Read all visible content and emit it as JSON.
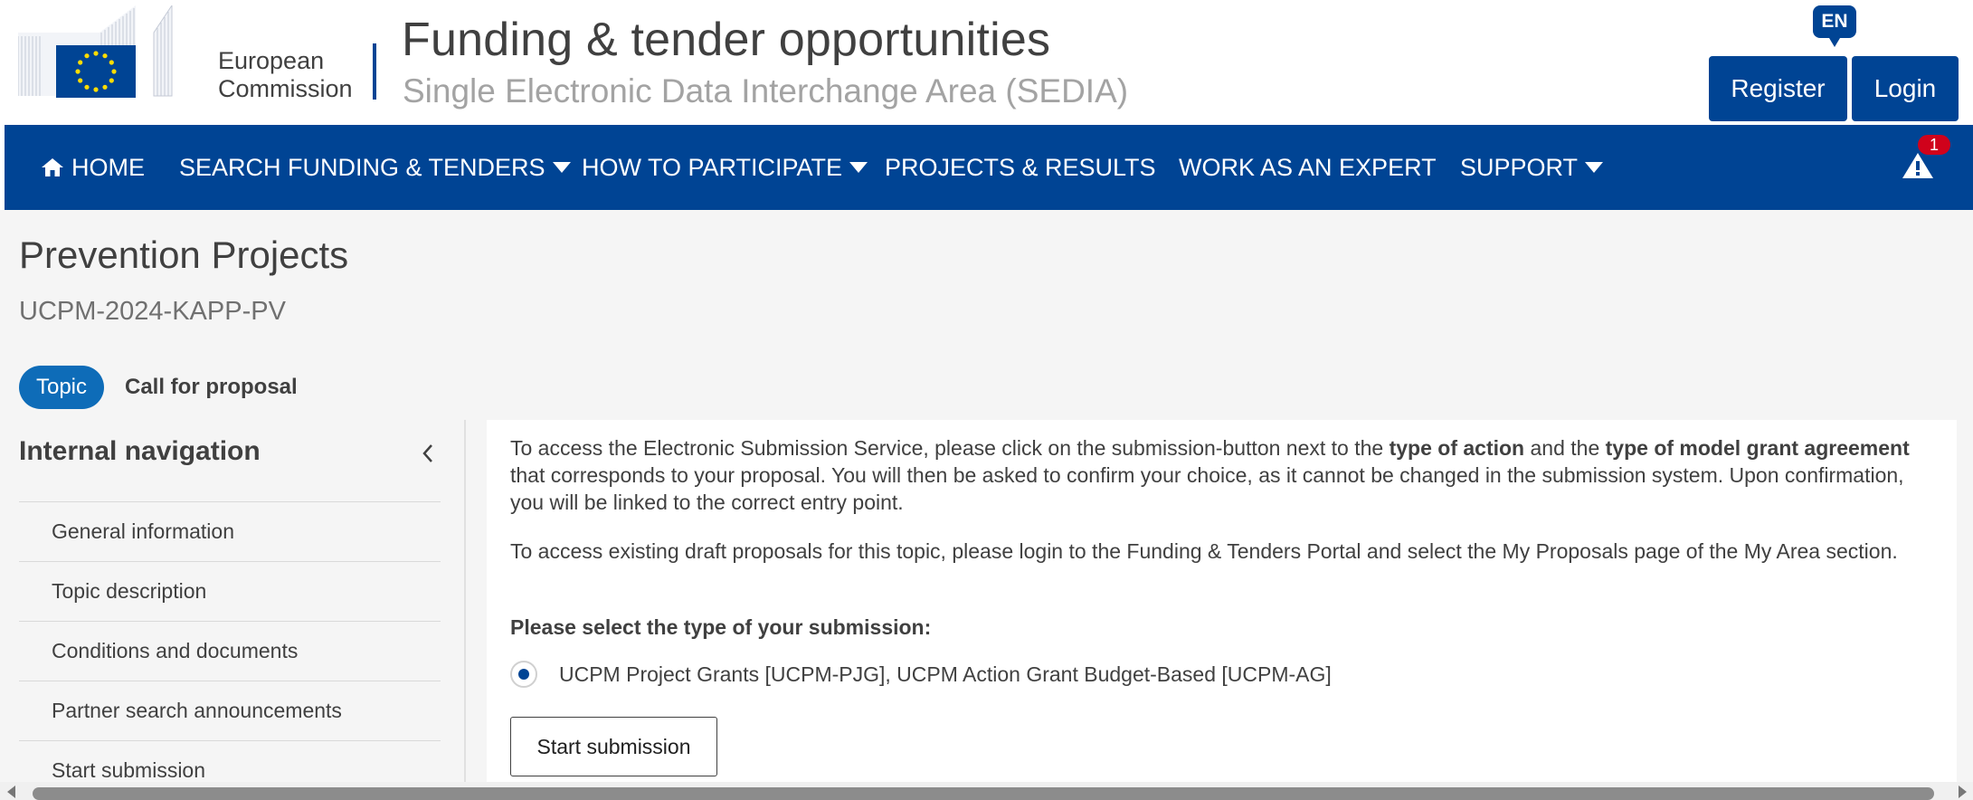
{
  "header": {
    "logo_text_line1": "European",
    "logo_text_line2": "Commission",
    "title": "Funding & tender opportunities",
    "subtitle": "Single Electronic Data Interchange Area (SEDIA)",
    "language": "EN",
    "register_label": "Register",
    "login_label": "Login"
  },
  "nav": {
    "items": [
      {
        "label": "HOME",
        "icon": "home-icon"
      },
      {
        "label": "SEARCH FUNDING & TENDERS",
        "dropdown": true
      },
      {
        "label": "HOW TO PARTICIPATE",
        "dropdown": true
      },
      {
        "label": "PROJECTS & RESULTS"
      },
      {
        "label": "WORK AS AN EXPERT"
      },
      {
        "label": "SUPPORT",
        "dropdown": true
      }
    ],
    "alert_count": "1",
    "alert_icon": "warning-icon"
  },
  "page": {
    "title": "Prevention Projects",
    "identifier": "UCPM-2024-KAPP-PV",
    "pill": "Topic",
    "call_label": "Call for proposal"
  },
  "sidebar": {
    "title": "Internal navigation",
    "items": [
      {
        "label": "General information"
      },
      {
        "label": "Topic description"
      },
      {
        "label": "Conditions and documents"
      },
      {
        "label": "Partner search announcements"
      },
      {
        "label": "Start submission"
      }
    ]
  },
  "content": {
    "p1_a": "To access the Electronic Submission Service, please click on the submission-button next to the ",
    "p1_b": "type of action",
    "p1_c": " and the ",
    "p1_d": "type of model grant agreement",
    "p1_e": " that corresponds to your proposal. You will then be asked to confirm your choice, as it cannot be changed in the submission system. Upon confirmation, you will be linked to the correct entry point.",
    "p2": "To access existing draft proposals for this topic, please login to the Funding & Tenders Portal and select the My Proposals page of the My Area section.",
    "select_label": "Please select the type of your submission:",
    "radio_option": "UCPM Project Grants [UCPM-PJG], UCPM Action Grant Budget-Based [UCPM-AG]",
    "start_button": "Start submission"
  },
  "colors": {
    "brand_blue": "#004494",
    "pill_blue": "#0e6cb8",
    "alert_red": "#d0021b",
    "eu_yellow": "#ffdd00"
  }
}
